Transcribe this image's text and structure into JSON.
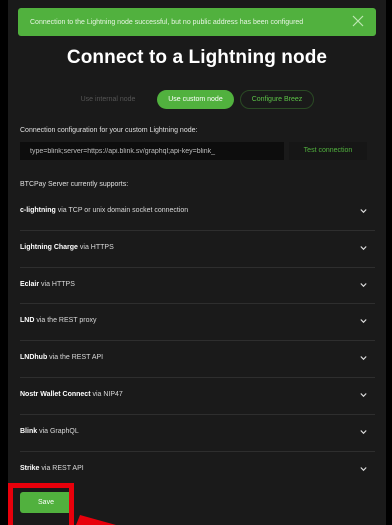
{
  "alert": {
    "text": "Connection to the Lightning node successful, but no public address has been configured",
    "close_icon": "close-icon",
    "color": "#51b13e"
  },
  "page_title": "Connect to a Lightning node",
  "node_toggle": {
    "internal": "Use internal node",
    "custom": "Use custom node",
    "breez": "Configure Breez",
    "selected": "Use custom node"
  },
  "connection": {
    "label": "Connection configuration for your custom Lightning node:",
    "value": "type=blink;server=https://api.blink.sv/graphql;api-key=blink_",
    "test_button": "Test connection"
  },
  "supports_label": "BTCPay Server currently supports:",
  "implementations": [
    {
      "name": "c-lightning",
      "via": " via TCP or unix domain socket connection"
    },
    {
      "name": "Lightning Charge",
      "via": " via HTTPS"
    },
    {
      "name": "Eclair",
      "via": " via HTTPS"
    },
    {
      "name": "LND",
      "via": " via the REST proxy"
    },
    {
      "name": "LNDhub",
      "via": " via the REST API"
    },
    {
      "name": "Nostr Wallet Connect",
      "via": " via NIP47"
    },
    {
      "name": "Blink",
      "via": " via GraphQL"
    },
    {
      "name": "Strike",
      "via": " via REST API"
    }
  ],
  "save_button": "Save",
  "colors": {
    "accent": "#51b13e",
    "background": "#1a1a1a",
    "highlight": "#e8000b"
  }
}
